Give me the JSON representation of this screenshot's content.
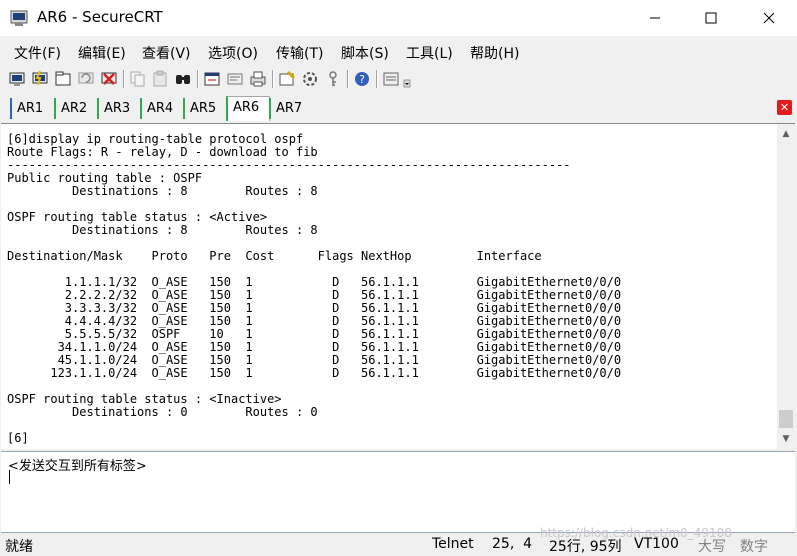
{
  "window": {
    "title": "AR6 - SecureCRT",
    "minimize_glyph": "—",
    "maximize_glyph": "☐",
    "close_glyph": "✕"
  },
  "menu": [
    "文件(F)",
    "编辑(E)",
    "查看(V)",
    "选项(O)",
    "传输(T)",
    "脚本(S)",
    "工具(L)",
    "帮助(H)"
  ],
  "toolbar_icons": [
    "connect-icon",
    "quick-connect-icon",
    "connect-tab-icon",
    "reconnect-icon",
    "disconnect-icon",
    "copy-icon",
    "paste-icon",
    "find-icon",
    "new-window-icon",
    "session-options-icon",
    "print-icon",
    "properties-icon",
    "sftp-icon",
    "keymap-icon",
    "help-icon",
    "toolbar-options-icon"
  ],
  "tabs": [
    {
      "label": "AR1"
    },
    {
      "label": "AR2"
    },
    {
      "label": "AR3"
    },
    {
      "label": "AR4"
    },
    {
      "label": "AR5"
    },
    {
      "label": "AR6",
      "active": true
    },
    {
      "label": "AR7"
    }
  ],
  "tab_close_glyph": "✕",
  "terminal": {
    "text": "[6]display ip routing-table protocol ospf\nRoute Flags: R - relay, D - download to fib\n------------------------------------------------------------------------------\nPublic routing table : OSPF\n         Destinations : 8        Routes : 8\n\nOSPF routing table status : <Active>\n         Destinations : 8        Routes : 8\n\nDestination/Mask    Proto   Pre  Cost      Flags NextHop         Interface\n\n        1.1.1.1/32  O_ASE   150  1           D   56.1.1.1        GigabitEthernet0/0/0\n        2.2.2.2/32  O_ASE   150  1           D   56.1.1.1        GigabitEthernet0/0/0\n        3.3.3.3/32  O_ASE   150  1           D   56.1.1.1        GigabitEthernet0/0/0\n        4.4.4.4/32  O_ASE   150  1           D   56.1.1.1        GigabitEthernet0/0/0\n        5.5.5.5/32  OSPF    10   1           D   56.1.1.1        GigabitEthernet0/0/0\n       34.1.1.0/24  O_ASE   150  1           D   56.1.1.1        GigabitEthernet0/0/0\n       45.1.1.0/24  O_ASE   150  1           D   56.1.1.1        GigabitEthernet0/0/0\n      123.1.1.0/24  O_ASE   150  1           D   56.1.1.1        GigabitEthernet0/0/0\n\nOSPF routing table status : <Inactive>\n         Destinations : 0        Routes : 0\n\n[6]"
  },
  "chat": {
    "placeholder": "<发送交互到所有标签>"
  },
  "status": {
    "ready": "就绪",
    "protocol": "Telnet",
    "cursor": "25,  4",
    "size": "25行, 95列",
    "terminal_type": "VT100",
    "caps": "大写",
    "num": "数字"
  },
  "watermark": "https://blog.csdn.net/m0_49108"
}
